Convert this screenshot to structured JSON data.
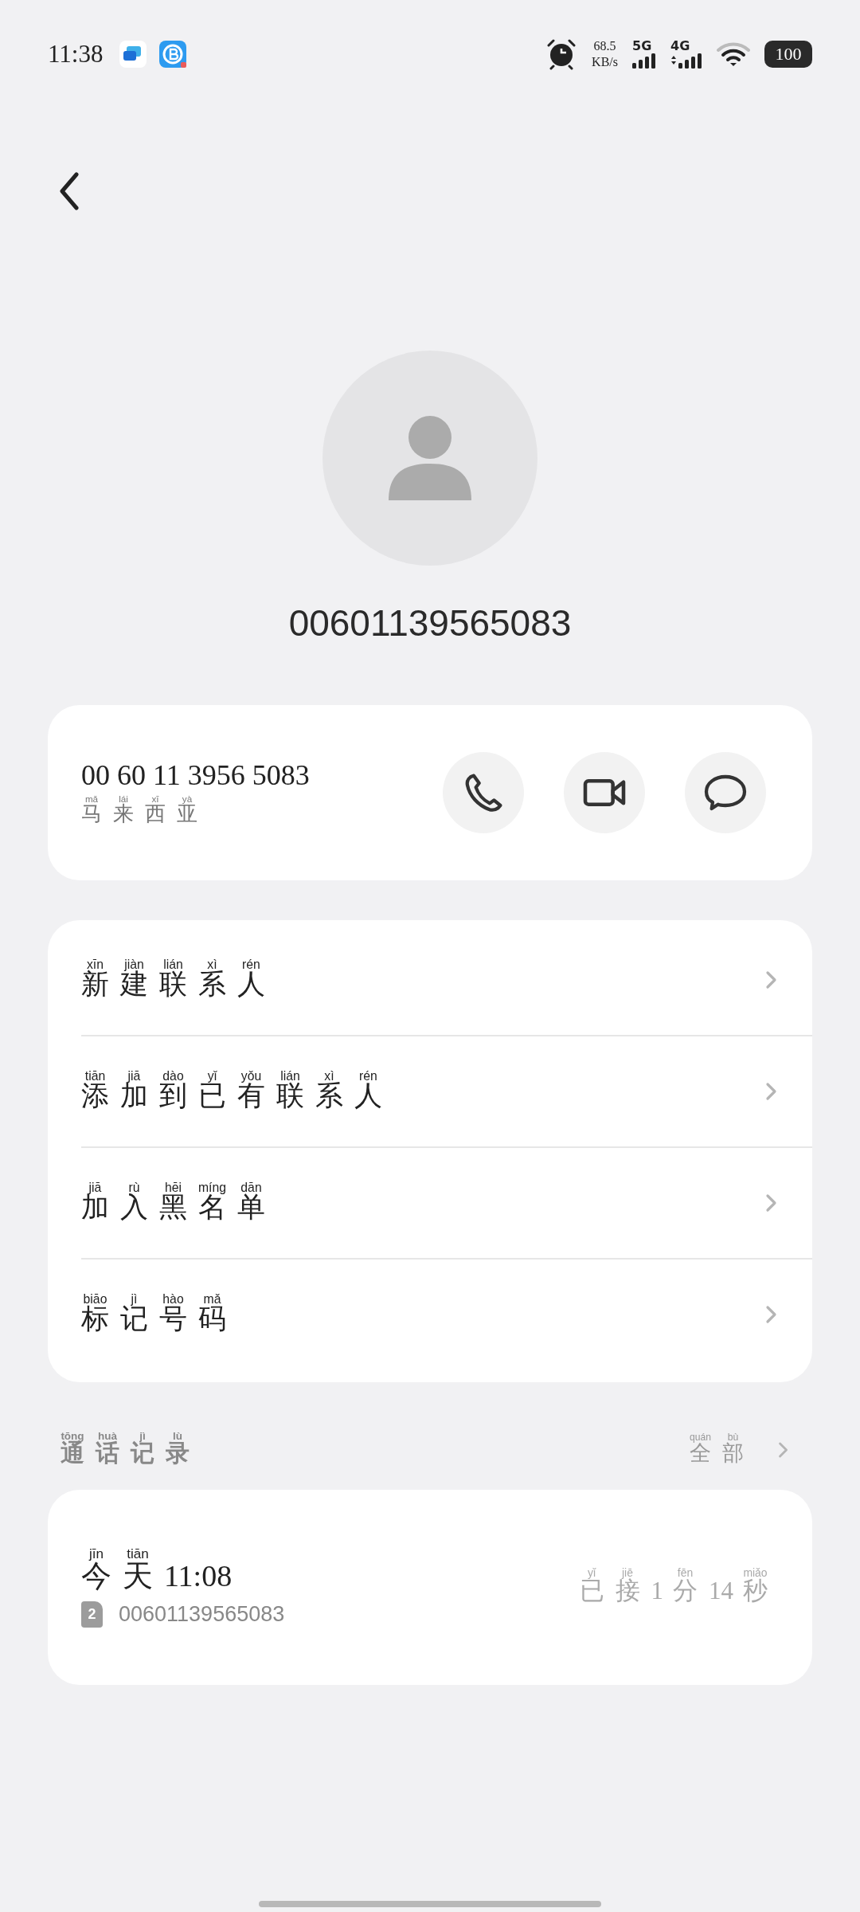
{
  "status_bar": {
    "time": "11:38",
    "net_speed": "68.5",
    "net_unit": "KB/s",
    "signals": [
      {
        "label": "5G",
        "kind": "plain"
      },
      {
        "label": "4G",
        "kind": "arrows"
      }
    ],
    "battery": "100"
  },
  "contact": {
    "title": "00601139565083"
  },
  "number_card": {
    "number": "00 60 11 3956 5083",
    "region": [
      {
        "text": "马",
        "ruby": "mǎ"
      },
      {
        "text": "来",
        "ruby": "lái"
      },
      {
        "text": "西",
        "ruby": "xī"
      },
      {
        "text": "亚",
        "ruby": "yà"
      }
    ],
    "actions": [
      {
        "kind": "call"
      },
      {
        "kind": "video"
      },
      {
        "kind": "message"
      }
    ]
  },
  "menu": [
    {
      "label": [
        {
          "text": "新",
          "ruby": "xīn"
        },
        {
          "text": "建",
          "ruby": "jiàn"
        },
        {
          "text": "联",
          "ruby": "lián"
        },
        {
          "text": "系",
          "ruby": "xì"
        },
        {
          "text": "人",
          "ruby": "rén"
        }
      ]
    },
    {
      "label": [
        {
          "text": "添",
          "ruby": "tiān"
        },
        {
          "text": "加",
          "ruby": "jiā"
        },
        {
          "text": "到",
          "ruby": "dào"
        },
        {
          "text": "已",
          "ruby": "yǐ"
        },
        {
          "text": "有",
          "ruby": "yǒu"
        },
        {
          "text": "联",
          "ruby": "lián"
        },
        {
          "text": "系",
          "ruby": "xì"
        },
        {
          "text": "人",
          "ruby": "rén"
        }
      ]
    },
    {
      "label": [
        {
          "text": "加",
          "ruby": "jiā"
        },
        {
          "text": "入",
          "ruby": "rù"
        },
        {
          "text": "黑",
          "ruby": "hēi"
        },
        {
          "text": "名",
          "ruby": "míng"
        },
        {
          "text": "单",
          "ruby": "dān"
        }
      ]
    },
    {
      "label": [
        {
          "text": "标",
          "ruby": "biāo"
        },
        {
          "text": "记",
          "ruby": "jì"
        },
        {
          "text": "号",
          "ruby": "hào"
        },
        {
          "text": "码",
          "ruby": "mǎ"
        }
      ]
    }
  ],
  "call_log": {
    "title": [
      {
        "text": "通",
        "ruby": "tōng"
      },
      {
        "text": "话",
        "ruby": "huà"
      },
      {
        "text": "记",
        "ruby": "jì"
      },
      {
        "text": "录",
        "ruby": "lù"
      }
    ],
    "all_link": [
      {
        "text": "全",
        "ruby": "quán"
      },
      {
        "text": "部",
        "ruby": "bù"
      }
    ],
    "entries": [
      {
        "when": [
          {
            "text": "今",
            "ruby": "jīn"
          },
          {
            "text": "天",
            "ruby": "tiān"
          },
          {
            "text": "11:08"
          }
        ],
        "sim_slot": "2",
        "number": "00601139565083",
        "duration": [
          {
            "text": "已",
            "ruby": "yǐ"
          },
          {
            "text": "接",
            "ruby": "jiē"
          },
          {
            "text": "1"
          },
          {
            "text": "分",
            "ruby": "fēn"
          },
          {
            "text": "14"
          },
          {
            "text": "秒",
            "ruby": "miǎo"
          }
        ]
      }
    ]
  }
}
